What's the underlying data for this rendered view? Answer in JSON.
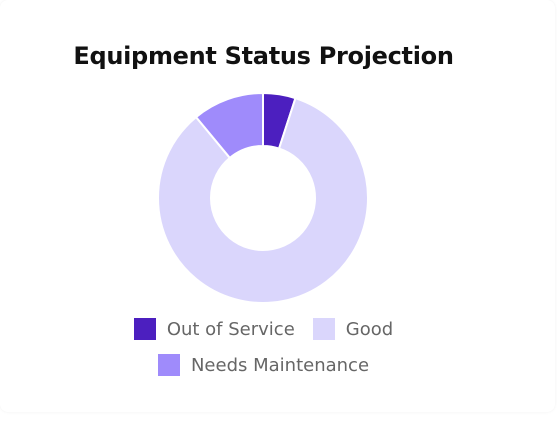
{
  "chart_data": {
    "type": "pie",
    "title": "Equipment Status Projection",
    "categories": [
      "Out of Service",
      "Good",
      "Needs Maintenance"
    ],
    "values": [
      5,
      84,
      11
    ],
    "colors": [
      "#4c1fbf",
      "#dad6fc",
      "#9f8bfb"
    ],
    "donut": true,
    "legend_position": "bottom"
  }
}
